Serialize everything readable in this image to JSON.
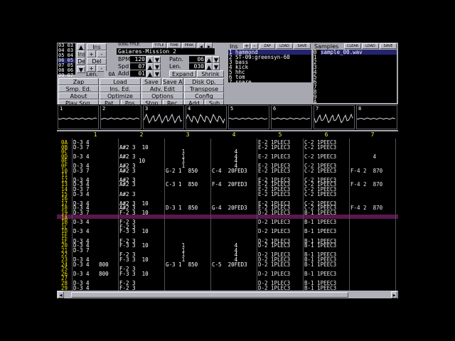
{
  "positions": [
    "03",
    "04",
    "05",
    "06",
    "07",
    "08",
    "09"
  ],
  "position_values": [
    "03",
    "03",
    "04",
    "05",
    "05",
    "06",
    "07"
  ],
  "pos_buttons": {
    "ins": "Ins",
    "del": "Del",
    "plus": "+",
    "minus": "-"
  },
  "header": {
    "song_title_label": "SONG TITLE:",
    "title_btn": "TITLE",
    "time_btn": "TIME",
    "peak_btn": "PEAK",
    "song_title": "Gaiares-Mission 2"
  },
  "params": {
    "bpm_label": "BPM",
    "bpm": "120",
    "spd_label": "Spd",
    "spd": "07",
    "len_label": "Len.",
    "len": "0A",
    "add_label": "Add",
    "add": "01",
    "patn_label": "Patn.",
    "patn": "06",
    "plen_label": "Len.",
    "plen": "030"
  },
  "pat_buttons": {
    "expand": "Expand",
    "shrink": "Shrink"
  },
  "menu": [
    [
      "Zap",
      "Load",
      "Save",
      "Save As...",
      "Disk Op."
    ],
    [
      "Smp. Ed.",
      "Ins. Ed.",
      "Adv. Edit",
      "Transpose"
    ],
    [
      "About",
      "Optimize",
      "Options",
      "Config"
    ],
    [
      "Play Sng.",
      "Pat.",
      "Pos.",
      "Stop",
      "Rec.",
      "Add",
      "Sub"
    ]
  ],
  "ins_panel": {
    "label": "Ins",
    "zap": "ZAP",
    "load": "LOAD",
    "save": "SAVE"
  },
  "instruments": [
    "1 hammond",
    "2 ST-09:greensyn-60",
    "3 bass",
    "4 kick",
    "5 hhc",
    "6 tom",
    "7 snare"
  ],
  "samples_panel": {
    "label": "Samples",
    "clear": "CLEAR",
    "load": "LOAD",
    "save": "SAVE"
  },
  "sample_nums": [
    "0",
    "1",
    "2",
    "3",
    "4",
    "5",
    "6",
    "7",
    "8",
    "9",
    "A",
    "B"
  ],
  "samples": [
    "sample_00.wav"
  ],
  "scopes": [
    "1",
    "2",
    "3",
    "4",
    "5",
    "6",
    "7",
    "8"
  ],
  "channel_numbers": [
    "1",
    "2",
    "3",
    "4",
    "5",
    "6",
    "7"
  ],
  "rows": [
    {
      "n": "0A",
      "c": [
        "D-3 4",
        "",
        "",
        "",
        "E-2 1PLEC3",
        "C-2 1PEEC3",
        ""
      ]
    },
    {
      "n": "0B",
      "c": [
        "D-3 7",
        "A#2 3  10",
        "",
        "",
        "E-2 1PLEC3",
        "C-2 1PEEC3",
        ""
      ]
    },
    {
      "n": "0C",
      "c": [
        "",
        "",
        "     1",
        "       4",
        "",
        "",
        ""
      ]
    },
    {
      "n": "0D",
      "c": [
        "D-3 4",
        "A#2 3",
        "     1",
        "       4",
        "E-2 1PLEC3",
        "C-2 1PEEC3",
        "       4"
      ]
    },
    {
      "n": "0E",
      "c": [
        "",
        "      10",
        "     1",
        "       4",
        "",
        "",
        ""
      ]
    },
    {
      "n": "0F",
      "c": [
        "D-3 4",
        "A#2 3",
        "     1",
        "       4",
        "E-2 1PLEC3",
        "C-2 1PEEC3",
        ""
      ]
    },
    {
      "n": "10",
      "c": [
        "D-3 7",
        "A#2 3",
        "G-2 1  850",
        "C-4  20FED3",
        "E-2 1PLEC3",
        "C-2 1PEEC3",
        "F-4 2  870"
      ]
    },
    {
      "n": "11",
      "c": [
        "",
        "",
        "",
        "",
        "",
        "",
        ""
      ]
    },
    {
      "n": "12",
      "c": [
        "D-3 4",
        "A#2 3",
        "",
        "",
        "E-2 1PLEC3",
        "C-2 1PEEC3",
        ""
      ]
    },
    {
      "n": "13",
      "c": [
        "D-3 4",
        "A#2 3",
        "C-3 1  850",
        "F-4  20FED3",
        "E-2 1PLEC3",
        "C-2 1PEEC3",
        "F-4 2  870"
      ]
    },
    {
      "n": "14",
      "c": [
        "D-3 7",
        "",
        "",
        "",
        "E-2 1PLEC3",
        "C-2 1PEEC3",
        ""
      ]
    },
    {
      "n": "15",
      "c": [
        "D-3 4",
        "A#2 3",
        "",
        "",
        "E-2 1PLEC3",
        "C-2 1PEEC3",
        ""
      ]
    },
    {
      "n": "16",
      "c": [
        "",
        "",
        "",
        "",
        "",
        "",
        ""
      ]
    },
    {
      "n": "17",
      "c": [
        "D-3 4",
        "A#2 3  10",
        "",
        "",
        "E-2 1PLEC3",
        "C-2 1PEEC3",
        ""
      ]
    },
    {
      "n": "18",
      "c": [
        "D-3 4",
        "A#2 3",
        "D-3 1  850",
        "G-4  20FED3",
        "E-2 1PLEC3",
        "C-2 1PEEC3",
        "F-4 2  870"
      ]
    },
    {
      "n": "19",
      "c": [
        "D-3 7",
        "F-2 3  10",
        "",
        "",
        "D-2 1PLEC3",
        "B-1 1PEEC3",
        ""
      ]
    },
    {
      "n": "1A",
      "c": [
        "",
        "",
        "",
        "",
        "",
        "",
        ""
      ]
    },
    {
      "n": "1B",
      "c": [
        "D-3 4",
        "F-2 3",
        "",
        "",
        "D-2 1PLEC3",
        "B-1 1PEEC3",
        ""
      ]
    },
    {
      "n": "1C",
      "c": [
        "",
        "F-2 3",
        "",
        "",
        "",
        "",
        ""
      ]
    },
    {
      "n": "1D",
      "c": [
        "D-3 4",
        "F-3 3  10",
        "",
        "",
        "D-2 1PLEC3",
        "B-1 1PEEC3",
        ""
      ]
    },
    {
      "n": "1E",
      "c": [
        "",
        "",
        "",
        "",
        "",
        "",
        ""
      ]
    },
    {
      "n": "1F",
      "c": [
        "D-3 4",
        "F-2 3",
        "",
        "",
        "D-2 1PLEC3",
        "B-1 1PEEC3",
        ""
      ]
    },
    {
      "n": "20",
      "c": [
        "D-3 4",
        "F-3 3  10",
        "     1",
        "       4",
        "D-2 1PLEC3",
        "B-1 1PEEC3",
        ""
      ]
    },
    {
      "n": "21",
      "c": [
        "D-3 7",
        "",
        "     1",
        "       4",
        "",
        "",
        ""
      ]
    },
    {
      "n": "22",
      "c": [
        "",
        "F-2 3",
        "     1",
        "       4",
        "D-2 1PLEC3",
        "B-1 1PEEC3",
        ""
      ]
    },
    {
      "n": "23",
      "c": [
        "D-3 4",
        "F-3 3  10",
        "     1",
        "       4",
        "D-2 1PLEC3",
        "B-1 1PEEC3",
        ""
      ]
    },
    {
      "n": "24",
      "c": [
        "D-3 4   800",
        "",
        "G-3 1  850",
        "C-5  20FED3",
        "D-2 1PLEC3",
        "B-1 1PEEC3",
        ""
      ]
    },
    {
      "n": "25",
      "c": [
        "",
        "F-2 3",
        "",
        "",
        "",
        "",
        ""
      ]
    },
    {
      "n": "26",
      "c": [
        "D-3 4   800",
        "F-3 3  10",
        "",
        "",
        "D-2 1PLEC3",
        "B-1 1PEEC3",
        ""
      ]
    },
    {
      "n": "27",
      "c": [
        "",
        "",
        "",
        "",
        "",
        "",
        ""
      ]
    },
    {
      "n": "28",
      "c": [
        "D-3 4",
        "F-2 3",
        "",
        "",
        "D-2 1PLEC3",
        "B-1 1PEEC3",
        ""
      ]
    },
    {
      "n": "29",
      "c": [
        "D-3 4",
        "F-2 3",
        "",
        "",
        "D-2 1PLEC3",
        "B-1 1PEEC3",
        ""
      ]
    }
  ]
}
